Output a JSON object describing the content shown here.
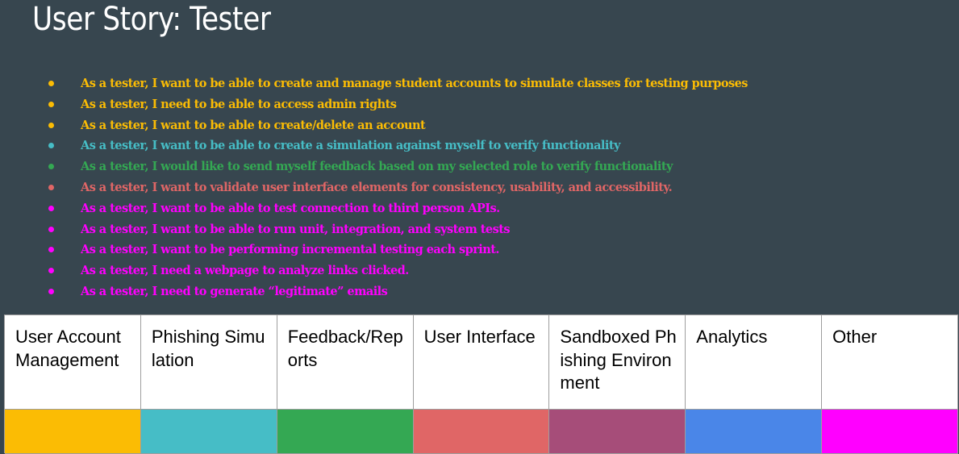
{
  "title": "User Story: Tester",
  "stories": [
    {
      "text": "As a tester, I want to be able to create and manage student accounts to simulate classes for testing purposes",
      "color": "#fbbc04"
    },
    {
      "text": "As a tester, I need to be able to access admin rights",
      "color": "#fbbc04"
    },
    {
      "text": "As a tester, I want to be able to create/delete an account",
      "color": "#fbbc04"
    },
    {
      "text": "As a tester, I want to be able to create a simulation against myself to verify functionality",
      "color": "#46bdc6"
    },
    {
      "text": "As a tester, I would like to send myself feedback based on my selected role to verify functionality",
      "color": "#34a853"
    },
    {
      "text": "As a tester, I want to validate user interface elements for consistency, usability, and accessibility.",
      "color": "#e06666"
    },
    {
      "text": "As a tester, I want to be able to test connection to third person APIs.",
      "color": "#ff00ff"
    },
    {
      "text": "As a tester, I want to be able to run unit, integration, and system tests",
      "color": "#ff00ff"
    },
    {
      "text": "As a tester, I want to be performing incremental testing each sprint.",
      "color": "#ff00ff"
    },
    {
      "text": "As a tester, I need a webpage to analyze links clicked.",
      "color": "#ff00ff"
    },
    {
      "text": "As a tester, I need to generate “legitimate” emails",
      "color": "#ff00ff"
    }
  ],
  "categories": [
    {
      "label": "User Account Management",
      "color": "#fbbc04"
    },
    {
      "label": "Phishing Simulation",
      "color": "#46bdc6"
    },
    {
      "label": "Feedback/Reports",
      "color": "#34a853"
    },
    {
      "label": "User Interface",
      "color": "#e06666"
    },
    {
      "label": "Sandboxed Phishing Environment",
      "color": "#a64d79"
    },
    {
      "label": "Analytics",
      "color": "#4a86e8"
    },
    {
      "label": "Other",
      "color": "#ff00ff"
    }
  ]
}
